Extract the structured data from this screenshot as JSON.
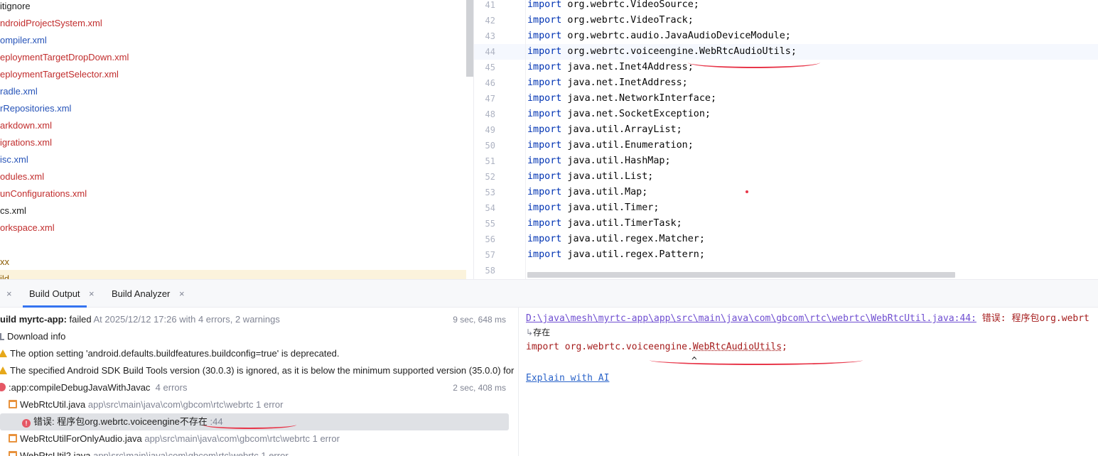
{
  "project_tree": {
    "items": [
      {
        "label": "itignore",
        "color": "#1e1e1e"
      },
      {
        "label": "ndroidProjectSystem.xml",
        "color": "#c12d2d"
      },
      {
        "label": "ompiler.xml",
        "color": "#2653b8"
      },
      {
        "label": "eploymentTargetDropDown.xml",
        "color": "#c12d2d"
      },
      {
        "label": "eploymentTargetSelector.xml",
        "color": "#c12d2d"
      },
      {
        "label": "radle.xml",
        "color": "#2653b8"
      },
      {
        "label": "rRepositories.xml",
        "color": "#2653b8"
      },
      {
        "label": "arkdown.xml",
        "color": "#c12d2d"
      },
      {
        "label": "igrations.xml",
        "color": "#c12d2d"
      },
      {
        "label": "isc.xml",
        "color": "#2653b8"
      },
      {
        "label": "odules.xml",
        "color": "#c12d2d"
      },
      {
        "label": "unConfigurations.xml",
        "color": "#c12d2d"
      },
      {
        "label": "cs.xml",
        "color": "#1e1e1e"
      },
      {
        "label": "orkspace.xml",
        "color": "#c12d2d"
      },
      {
        "label": "",
        "color": "#1e1e1e"
      },
      {
        "label": "xx",
        "color": "#8a5a00"
      },
      {
        "label": "ild",
        "color": "#8a5a00"
      }
    ]
  },
  "editor": {
    "lines": [
      {
        "num": "41",
        "kw": "import",
        "rest": " org.webrtc.VideoSource;"
      },
      {
        "num": "42",
        "kw": "import",
        "rest": " org.webrtc.VideoTrack;"
      },
      {
        "num": "43",
        "kw": "import",
        "rest": " org.webrtc.audio.JavaAudioDeviceModule;"
      },
      {
        "num": "44",
        "kw": "import",
        "rest": " org.webrtc.voiceengine.WebRtcAudioUtils;"
      },
      {
        "num": "45",
        "kw": "import",
        "rest": " java.net.Inet4Address;"
      },
      {
        "num": "46",
        "kw": "import",
        "rest": " java.net.InetAddress;"
      },
      {
        "num": "47",
        "kw": "import",
        "rest": " java.net.NetworkInterface;"
      },
      {
        "num": "48",
        "kw": "import",
        "rest": " java.net.SocketException;"
      },
      {
        "num": "49",
        "kw": "import",
        "rest": " java.util.ArrayList;"
      },
      {
        "num": "50",
        "kw": "import",
        "rest": " java.util.Enumeration;"
      },
      {
        "num": "51",
        "kw": "import",
        "rest": " java.util.HashMap;"
      },
      {
        "num": "52",
        "kw": "import",
        "rest": " java.util.List;"
      },
      {
        "num": "53",
        "kw": "import",
        "rest": " java.util.Map;"
      },
      {
        "num": "54",
        "kw": "import",
        "rest": " java.util.Timer;"
      },
      {
        "num": "55",
        "kw": "import",
        "rest": " java.util.TimerTask;"
      },
      {
        "num": "56",
        "kw": "import",
        "rest": " java.util.regex.Matcher;"
      },
      {
        "num": "57",
        "kw": "import",
        "rest": " java.util.regex.Pattern;"
      },
      {
        "num": "58",
        "kw": "",
        "rest": ""
      }
    ]
  },
  "tool_window": {
    "tabs": [
      {
        "label": "Build Output",
        "close": "×"
      },
      {
        "label": "Build Analyzer",
        "close": "×"
      }
    ],
    "left_close": "×"
  },
  "build_tree": {
    "root": {
      "prefix": "uild myrtc-app:",
      "status": " failed",
      "detail": " At 2025/12/12 17:26 with 4 errors, 2 warnings",
      "time": "9 sec, 648 ms"
    },
    "download": "Download info",
    "warnings": [
      "The option setting 'android.defaults.buildfeatures.buildconfig=true' is deprecated.",
      "The specified Android SDK Build Tools version (30.0.3) is ignored, as it is below the minimum supported version (35.0.0) for"
    ],
    "task": {
      "label": ":app:compileDebugJavaWithJavac",
      "count": "4 errors",
      "time": "2 sec, 408 ms"
    },
    "files": [
      {
        "name": "WebRtcUtil.java",
        "path": "app\\src\\main\\java\\com\\gbcom\\rtc\\webrtc",
        "count": "1 error"
      },
      {
        "name": "WebRtcUtilForOnlyAudio.java",
        "path": "app\\src\\main\\java\\com\\gbcom\\rtc\\webrtc",
        "count": "1 error"
      },
      {
        "name": "WebRtcUtil2.java",
        "path": "app\\src\\main\\java\\com\\gbcom\\rtc\\webrtc",
        "count": "1 error"
      }
    ],
    "selected_error": {
      "text": "错误: 程序包org.webrtc.voiceengine不存在",
      "line": ":44"
    }
  },
  "console": {
    "path_link": "D:\\java\\mesh\\myrtc-app\\app\\src\\main\\java\\com\\gbcom\\rtc\\webrtc\\WebRtcUtil.java:44:",
    "error_prefix": " 错误: 程序包org.webrt",
    "continuation": "存在",
    "code_before": "import org.webrtc.voiceengine.",
    "code_symbol": "WebRtcAudioUtils",
    "code_after": ";",
    "caret": "^",
    "explain_link": "Explain with AI"
  },
  "colors": {
    "keyword": "#0033b3",
    "error_text": "#a51c1c",
    "link": "#6f4ed1",
    "accent": "#3574f0",
    "annotation_red": "#e8374a"
  }
}
